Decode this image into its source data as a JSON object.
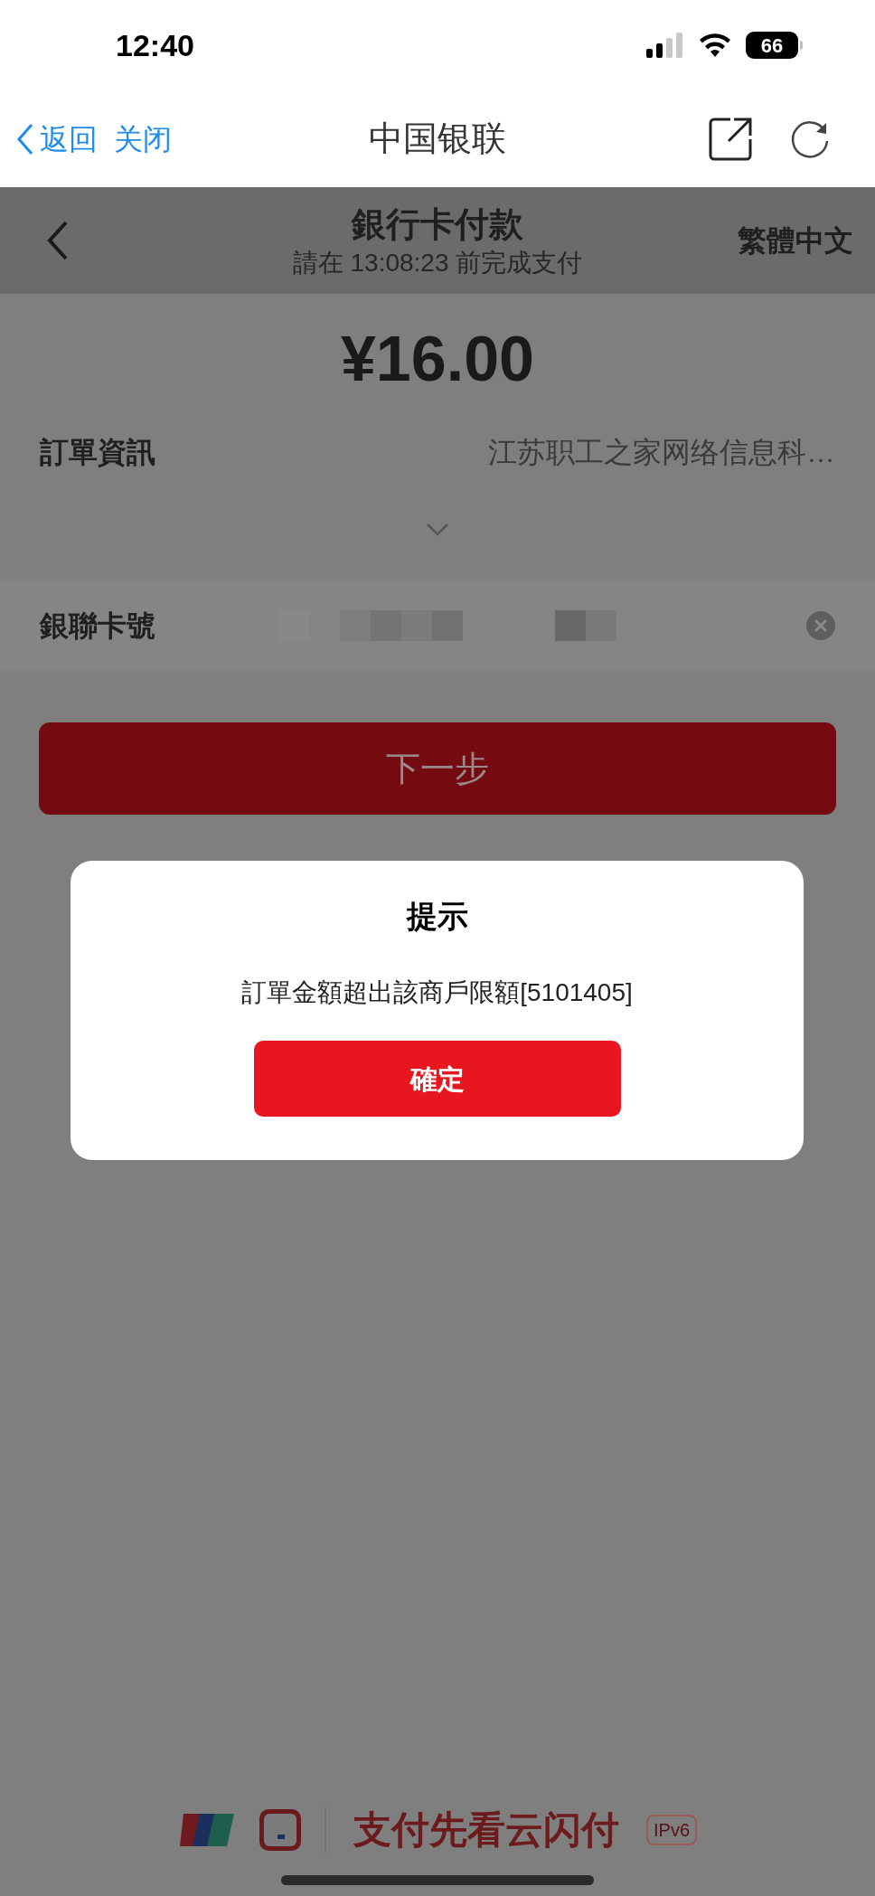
{
  "status_bar": {
    "time": "12:40",
    "battery": "66"
  },
  "browser_bar": {
    "back": "返回",
    "close": "关闭",
    "title": "中国银联"
  },
  "header": {
    "title": "銀行卡付款",
    "subtitle": "請在 13:08:23 前完成支付",
    "language": "繁體中文"
  },
  "amount": "¥16.00",
  "order_info": {
    "label": "訂單資訊",
    "value": "江苏职工之家网络信息科…",
    "expanded": false
  },
  "card_field": {
    "label": "銀聯卡號"
  },
  "next_button": {
    "label": "下一步",
    "disabled": true
  },
  "dialog": {
    "title": "提示",
    "message": "訂單金額超出該商戶限額[5101405]",
    "confirm": "確定"
  },
  "footer": {
    "slogan": "支付先看云闪付",
    "badge": "IPv6"
  }
}
